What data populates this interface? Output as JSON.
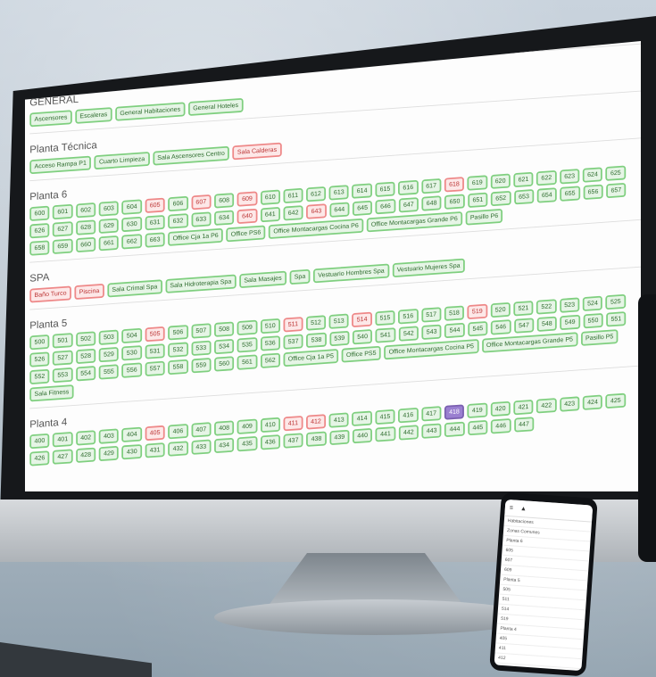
{
  "sections": [
    {
      "title": "GENERAL",
      "chips": [
        {
          "label": "Ascensores"
        },
        {
          "label": "Escaleras"
        },
        {
          "label": "General Habitaciones"
        },
        {
          "label": "General Hoteles"
        }
      ]
    },
    {
      "title": "Planta Técnica",
      "chips": [
        {
          "label": "Acceso Rampa P1"
        },
        {
          "label": "Cuarto Limpieza"
        },
        {
          "label": "Sala Ascensores Centro"
        },
        {
          "label": "Sala Calderas",
          "state": "red"
        }
      ]
    },
    {
      "title": "Planta 6",
      "chips": [
        {
          "label": "600"
        },
        {
          "label": "601"
        },
        {
          "label": "602"
        },
        {
          "label": "603"
        },
        {
          "label": "604"
        },
        {
          "label": "605",
          "state": "red"
        },
        {
          "label": "606"
        },
        {
          "label": "607",
          "state": "red"
        },
        {
          "label": "608"
        },
        {
          "label": "609",
          "state": "red"
        },
        {
          "label": "610"
        },
        {
          "label": "611"
        },
        {
          "label": "612"
        },
        {
          "label": "613"
        },
        {
          "label": "614"
        },
        {
          "label": "615"
        },
        {
          "label": "616"
        },
        {
          "label": "617"
        },
        {
          "label": "618",
          "state": "red"
        },
        {
          "label": "619"
        },
        {
          "label": "620"
        },
        {
          "label": "621"
        },
        {
          "label": "622"
        },
        {
          "label": "623"
        },
        {
          "label": "624"
        },
        {
          "label": "625"
        },
        {
          "label": "626"
        },
        {
          "label": "627"
        },
        {
          "label": "628"
        },
        {
          "label": "629"
        },
        {
          "label": "630"
        },
        {
          "label": "631"
        },
        {
          "label": "632"
        },
        {
          "label": "633"
        },
        {
          "label": "634"
        },
        {
          "label": "640",
          "state": "red"
        },
        {
          "label": "641"
        },
        {
          "label": "642"
        },
        {
          "label": "643",
          "state": "red"
        },
        {
          "label": "644"
        },
        {
          "label": "645"
        },
        {
          "label": "646"
        },
        {
          "label": "647"
        },
        {
          "label": "648"
        },
        {
          "label": "650"
        },
        {
          "label": "651"
        },
        {
          "label": "652"
        },
        {
          "label": "653"
        },
        {
          "label": "654"
        },
        {
          "label": "655"
        },
        {
          "label": "656"
        },
        {
          "label": "657"
        },
        {
          "label": "658"
        },
        {
          "label": "659"
        },
        {
          "label": "660"
        },
        {
          "label": "661"
        },
        {
          "label": "662"
        },
        {
          "label": "663"
        },
        {
          "label": "Office Cja 1a P6"
        },
        {
          "label": "Office PS6"
        },
        {
          "label": "Office Montacargas Cocina P6"
        },
        {
          "label": "Office Montacargas Grande P6"
        },
        {
          "label": "Pasillo P6"
        }
      ]
    },
    {
      "title": "SPA",
      "chips": [
        {
          "label": "Baño Turco",
          "state": "red"
        },
        {
          "label": "Piscina",
          "state": "red"
        },
        {
          "label": "Sala Crimal Spa"
        },
        {
          "label": "Sala Hidroterapia Spa"
        },
        {
          "label": "Sala Masajes"
        },
        {
          "label": "Spa"
        },
        {
          "label": "Vestuario Hombres Spa"
        },
        {
          "label": "Vestuario Mujeres Spa"
        }
      ]
    },
    {
      "title": "Planta 5",
      "chips": [
        {
          "label": "500"
        },
        {
          "label": "501"
        },
        {
          "label": "502"
        },
        {
          "label": "503"
        },
        {
          "label": "504"
        },
        {
          "label": "505",
          "state": "red"
        },
        {
          "label": "506"
        },
        {
          "label": "507"
        },
        {
          "label": "508"
        },
        {
          "label": "509"
        },
        {
          "label": "510"
        },
        {
          "label": "511",
          "state": "red"
        },
        {
          "label": "512"
        },
        {
          "label": "513"
        },
        {
          "label": "514",
          "state": "red"
        },
        {
          "label": "515"
        },
        {
          "label": "516"
        },
        {
          "label": "517"
        },
        {
          "label": "518"
        },
        {
          "label": "519",
          "state": "red"
        },
        {
          "label": "520"
        },
        {
          "label": "521"
        },
        {
          "label": "522"
        },
        {
          "label": "523"
        },
        {
          "label": "524"
        },
        {
          "label": "525"
        },
        {
          "label": "526"
        },
        {
          "label": "527"
        },
        {
          "label": "528"
        },
        {
          "label": "529"
        },
        {
          "label": "530"
        },
        {
          "label": "531"
        },
        {
          "label": "532"
        },
        {
          "label": "533"
        },
        {
          "label": "534"
        },
        {
          "label": "535"
        },
        {
          "label": "536"
        },
        {
          "label": "537"
        },
        {
          "label": "538"
        },
        {
          "label": "539"
        },
        {
          "label": "540"
        },
        {
          "label": "541"
        },
        {
          "label": "542"
        },
        {
          "label": "543"
        },
        {
          "label": "544"
        },
        {
          "label": "545"
        },
        {
          "label": "546"
        },
        {
          "label": "547"
        },
        {
          "label": "548"
        },
        {
          "label": "549"
        },
        {
          "label": "550"
        },
        {
          "label": "551"
        },
        {
          "label": "552"
        },
        {
          "label": "553"
        },
        {
          "label": "554"
        },
        {
          "label": "555"
        },
        {
          "label": "556"
        },
        {
          "label": "557"
        },
        {
          "label": "558"
        },
        {
          "label": "559"
        },
        {
          "label": "560"
        },
        {
          "label": "561"
        },
        {
          "label": "562"
        },
        {
          "label": "Office Cja 1a P5"
        },
        {
          "label": "Office PS5"
        },
        {
          "label": "Office Montacargas Cocina P5"
        },
        {
          "label": "Office Montacargas Grande P5"
        },
        {
          "label": "Pasillo P5"
        },
        {
          "label": "Sala Fitness"
        }
      ]
    },
    {
      "title": "Planta 4",
      "chips": [
        {
          "label": "400"
        },
        {
          "label": "401"
        },
        {
          "label": "402"
        },
        {
          "label": "403"
        },
        {
          "label": "404"
        },
        {
          "label": "405",
          "state": "red"
        },
        {
          "label": "406"
        },
        {
          "label": "407"
        },
        {
          "label": "408"
        },
        {
          "label": "409"
        },
        {
          "label": "410"
        },
        {
          "label": "411",
          "state": "red"
        },
        {
          "label": "412",
          "state": "red"
        },
        {
          "label": "413"
        },
        {
          "label": "414"
        },
        {
          "label": "415"
        },
        {
          "label": "416"
        },
        {
          "label": "417"
        },
        {
          "label": "418",
          "state": "purple"
        },
        {
          "label": "419"
        },
        {
          "label": "420"
        },
        {
          "label": "421"
        },
        {
          "label": "422"
        },
        {
          "label": "423"
        },
        {
          "label": "424"
        },
        {
          "label": "425"
        },
        {
          "label": "426"
        },
        {
          "label": "427"
        },
        {
          "label": "428"
        },
        {
          "label": "429"
        },
        {
          "label": "430"
        },
        {
          "label": "431"
        },
        {
          "label": "432"
        },
        {
          "label": "433"
        },
        {
          "label": "434"
        },
        {
          "label": "435"
        },
        {
          "label": "436"
        },
        {
          "label": "437"
        },
        {
          "label": "438"
        },
        {
          "label": "439"
        },
        {
          "label": "440"
        },
        {
          "label": "441"
        },
        {
          "label": "442"
        },
        {
          "label": "443"
        },
        {
          "label": "444"
        },
        {
          "label": "445"
        },
        {
          "label": "446"
        },
        {
          "label": "447"
        }
      ]
    }
  ],
  "phone": {
    "rows": [
      "Habitaciones",
      "Zonas Comunes",
      "Planta 6",
      "605",
      "607",
      "609",
      "Planta 5",
      "505",
      "511",
      "514",
      "519",
      "Planta 4",
      "405",
      "411",
      "412"
    ]
  },
  "colors": {
    "ok_border": "#7fcf7f",
    "alert_border": "#e88",
    "purple": "#9a7fd0"
  }
}
